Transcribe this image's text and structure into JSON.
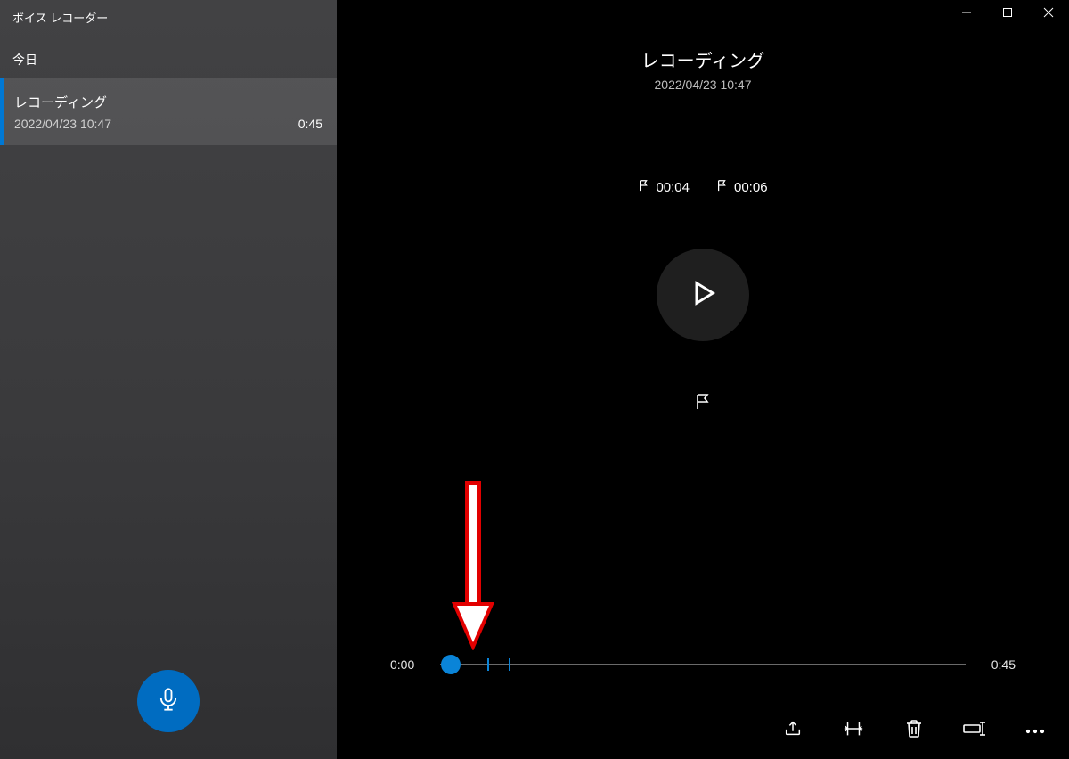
{
  "app": {
    "title": "ボイス レコーダー"
  },
  "sidebar": {
    "section_header": "今日",
    "items": [
      {
        "title": "レコーディング",
        "date": "2022/04/23 10:47",
        "duration": "0:45"
      }
    ]
  },
  "main": {
    "title": "レコーディング",
    "subtitle": "2022/04/23 10:47",
    "markers": [
      {
        "time": "00:04"
      },
      {
        "time": "00:06"
      }
    ],
    "timeline": {
      "current": "0:00",
      "total": "0:45",
      "thumb_pct": 2,
      "tick_pcts": [
        9,
        13
      ]
    }
  },
  "icons": {
    "mic": "mic-icon",
    "play": "play-icon",
    "flag": "flag-icon",
    "share": "share-icon",
    "trim": "trim-icon",
    "delete": "delete-icon",
    "rename": "rename-icon",
    "more": "more-icon",
    "minimize": "minimize-icon",
    "maximize": "maximize-icon",
    "close": "close-icon"
  }
}
